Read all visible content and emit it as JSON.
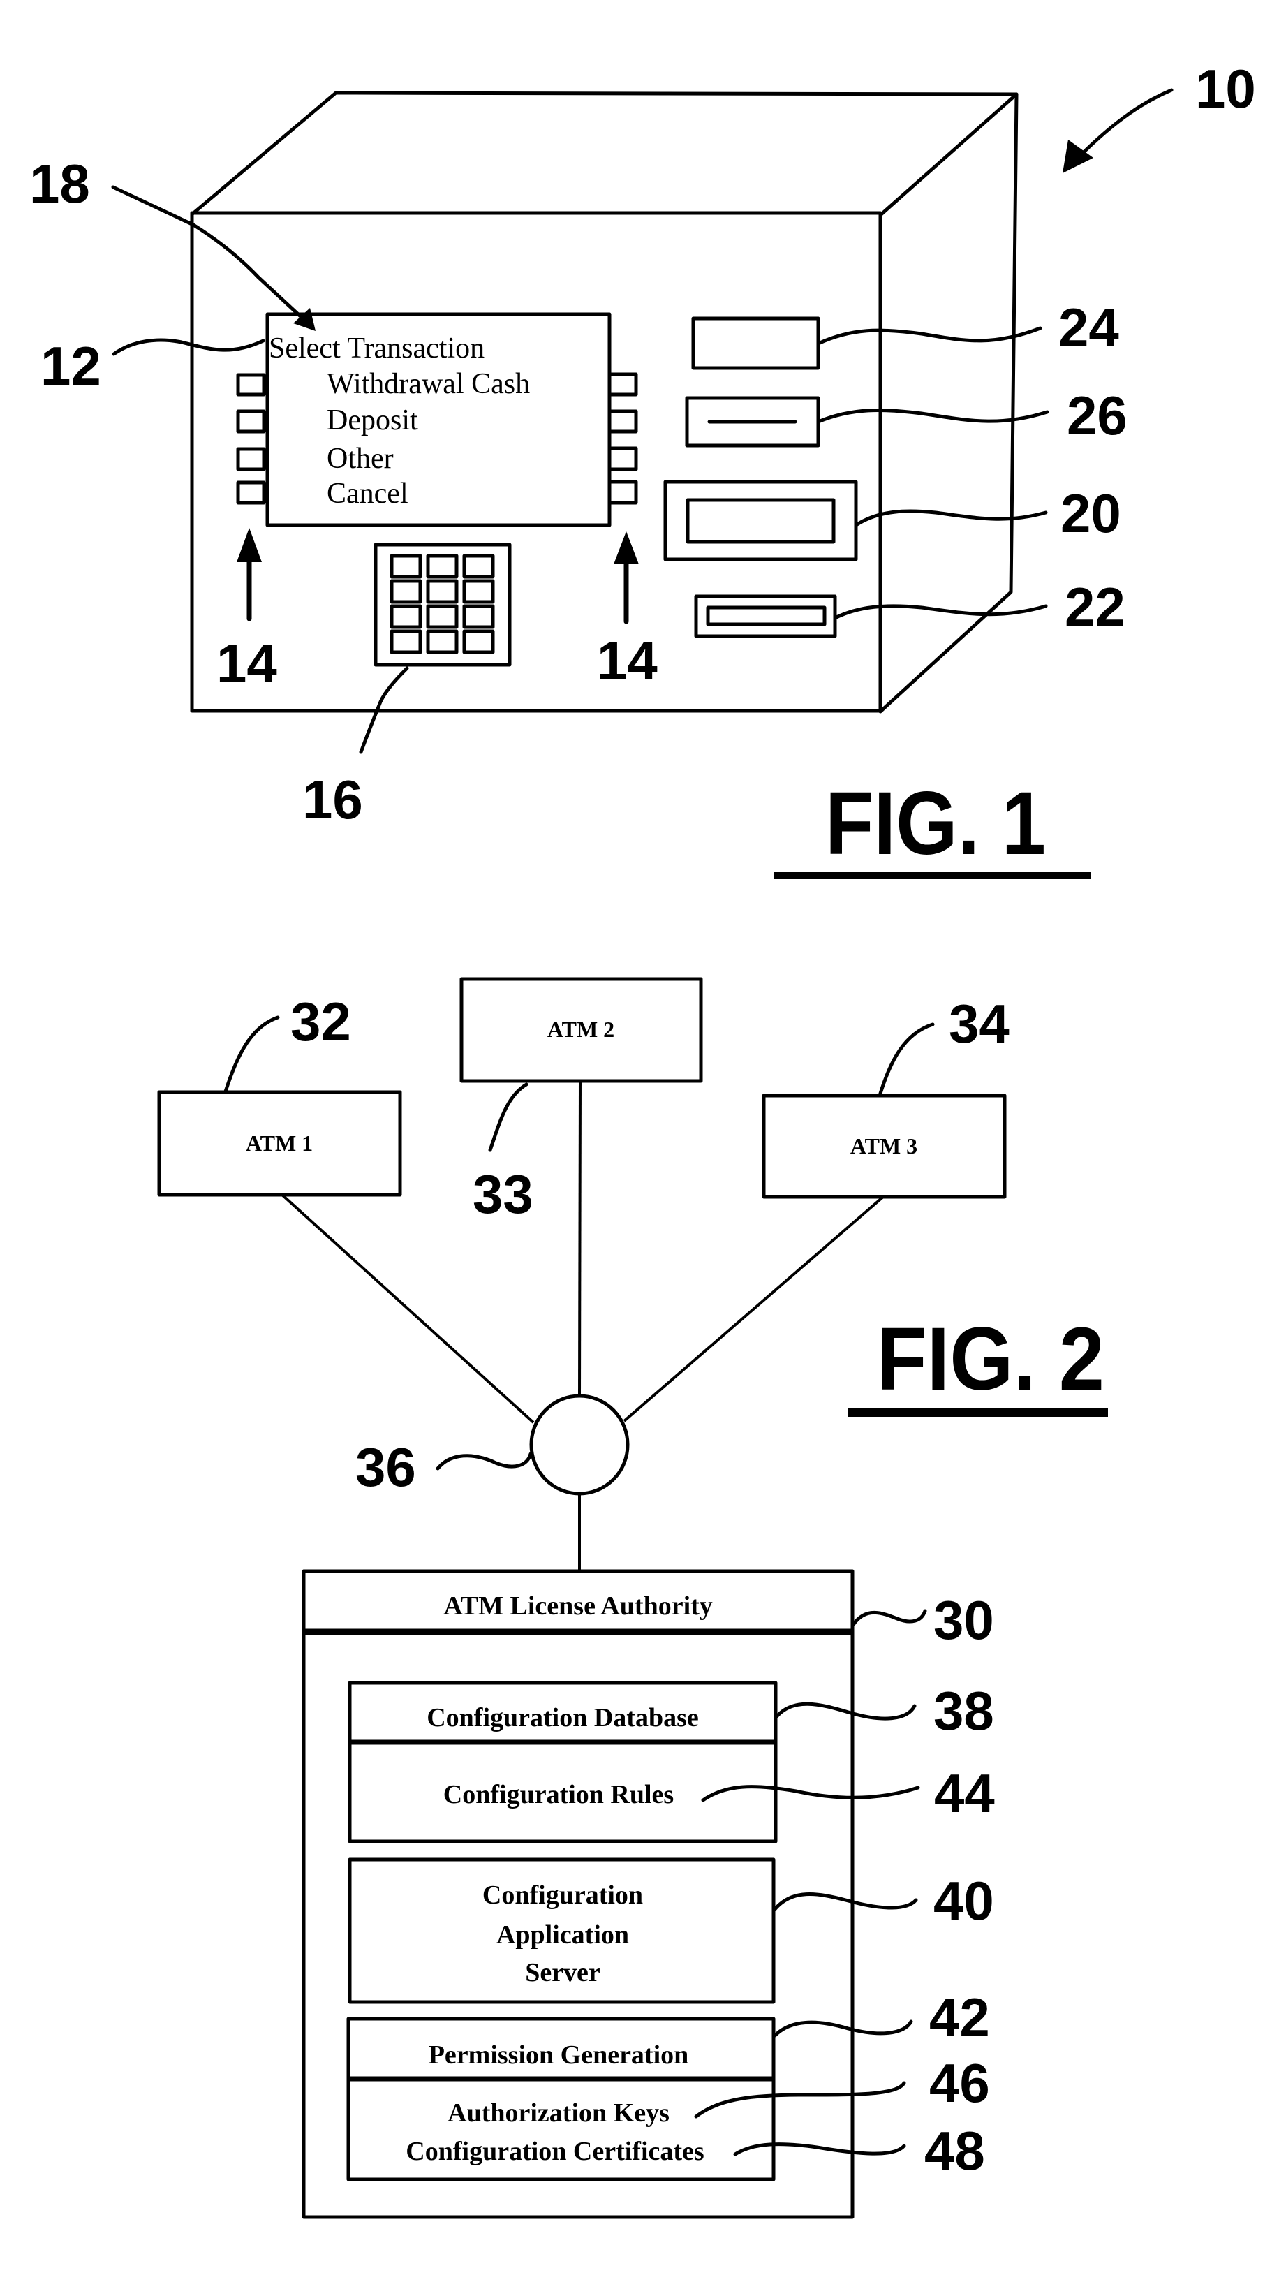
{
  "colors": {
    "ink": "#000000",
    "paper": "#ffffff"
  },
  "fig1": {
    "caption": "FIG. 1",
    "screen": {
      "title": "Select Transaction",
      "options": [
        "Withdrawal Cash",
        "Deposit",
        "Other",
        "Cancel"
      ]
    },
    "refs": {
      "atm": "10",
      "screen_text": "12",
      "function_keys_left": "14",
      "function_keys_right": "14",
      "keypad": "16",
      "display": "18",
      "cash_dispenser": "20",
      "card_reader": "22",
      "receipt_printer": "24",
      "deposit_slot": "26"
    },
    "function_keys_per_side": 4,
    "keypad_rows": 4,
    "keypad_cols": 3
  },
  "fig2": {
    "caption": "FIG. 2",
    "atms": [
      {
        "label": "ATM 1",
        "ref": "32"
      },
      {
        "label": "ATM 2",
        "ref": "33"
      },
      {
        "label": "ATM 3",
        "ref": "34"
      }
    ],
    "network_ref": "36",
    "authority": {
      "title": "ATM License Authority",
      "ref": "30",
      "config_db": {
        "title": "Configuration Database",
        "ref": "38",
        "rules": "Configuration Rules",
        "rules_ref": "44"
      },
      "app_server": {
        "lines": [
          "Configuration",
          "Application",
          "Server"
        ],
        "ref": "40"
      },
      "permission": {
        "title": "Permission Generation",
        "ref": "42",
        "keys": "Authorization Keys",
        "keys_ref": "46",
        "certs": "Configuration Certificates",
        "certs_ref": "48"
      }
    }
  }
}
